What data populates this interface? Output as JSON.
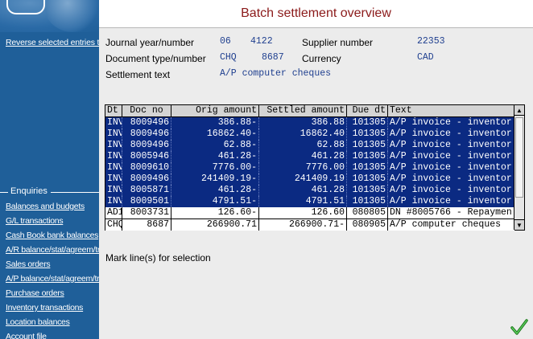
{
  "sidebar": {
    "reverse_link": "Reverse selected entries to c",
    "enquiries_heading": "Enquiries",
    "enquiries": [
      "Balances and budgets",
      "G/L transactions",
      "Cash Book bank balances",
      "A/R balance/stat/agreem/tran",
      "Sales orders",
      "A/P balance/stat/agreem/tran",
      "Purchase orders",
      "Inventory transactions",
      "Location balances",
      "Account file"
    ]
  },
  "header": {
    "title": "Batch settlement overview"
  },
  "form": {
    "journal_label": "Journal year/number",
    "journal_year": "06",
    "journal_number": "4122",
    "doctype_label": "Document type/number",
    "doc_type": "CHQ",
    "doc_number": "8687",
    "settlement_label": "Settlement text",
    "settlement_text": "A/P computer cheques",
    "supplier_label": "Supplier number",
    "supplier_number": "22353",
    "currency_label": "Currency",
    "currency": "CAD"
  },
  "grid": {
    "columns": [
      "Dt",
      "Doc no",
      "Orig amount",
      "Settled amount",
      "Due dt",
      "Text"
    ],
    "rows": [
      {
        "dt": "INV",
        "doc": "8009496",
        "orig": "386.88-",
        "settled": "386.88",
        "due": "101305",
        "text": "A/P invoice - inventor"
      },
      {
        "dt": "INV",
        "doc": "8009496",
        "orig": "16862.40-",
        "settled": "16862.40",
        "due": "101305",
        "text": "A/P invoice - inventor"
      },
      {
        "dt": "INV",
        "doc": "8009496",
        "orig": "62.88-",
        "settled": "62.88",
        "due": "101305",
        "text": "A/P invoice - inventor"
      },
      {
        "dt": "INV",
        "doc": "8005946",
        "orig": "461.28-",
        "settled": "461.28",
        "due": "101305",
        "text": "A/P invoice - inventor"
      },
      {
        "dt": "INV",
        "doc": "8009610",
        "orig": "7776.00-",
        "settled": "7776.00",
        "due": "101305",
        "text": "A/P invoice - inventor"
      },
      {
        "dt": "INV",
        "doc": "8009496",
        "orig": "241409.19-",
        "settled": "241409.19",
        "due": "101305",
        "text": "A/P invoice - inventor"
      },
      {
        "dt": "INV",
        "doc": "8005871",
        "orig": "461.28-",
        "settled": "461.28",
        "due": "101305",
        "text": "A/P invoice - inventor"
      },
      {
        "dt": "INV",
        "doc": "8009501",
        "orig": "4791.51-",
        "settled": "4791.51",
        "due": "101305",
        "text": "A/P invoice - inventor"
      },
      {
        "dt": "AD1",
        "doc": "8003731",
        "orig": "126.60-",
        "settled": "126.60",
        "due": "080805",
        "text": "DN #8005766 - Repaymen"
      }
    ],
    "total": {
      "dt": "CHQ",
      "doc": "8687",
      "orig": "266900.71",
      "settled": "266900.71-",
      "due": "080905",
      "text": "A/P computer cheques"
    }
  },
  "hint": "Mark line(s) for selection"
}
